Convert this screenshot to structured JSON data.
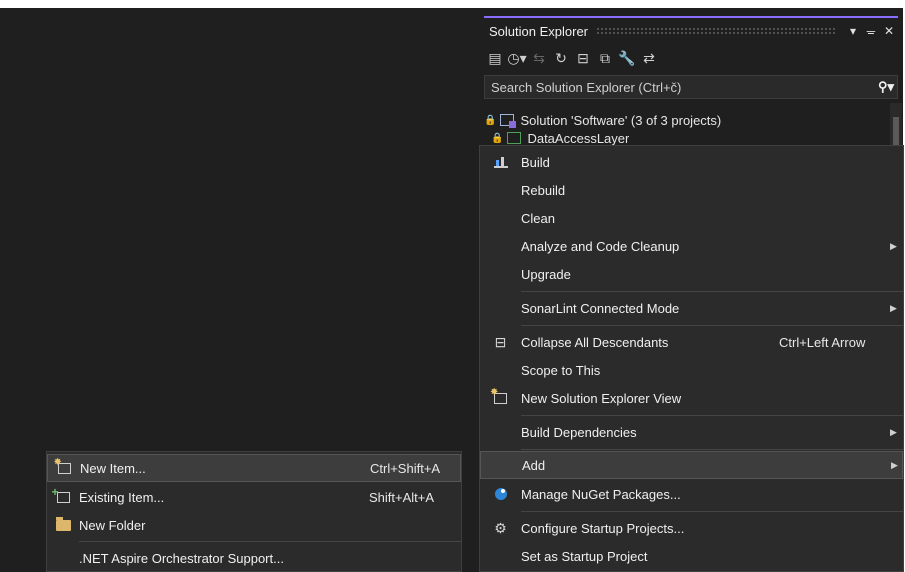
{
  "solution_explorer": {
    "title": "Solution Explorer",
    "controls": {
      "dropdown": "▾",
      "pin": "ᚚ",
      "close": "✕"
    },
    "search_placeholder": "Search Solution Explorer (Ctrl+č)",
    "tree": [
      {
        "label": "Solution 'Software' (3 of 3 projects)"
      },
      {
        "label": "DataAccessLayer"
      }
    ]
  },
  "context_menu": {
    "items": [
      {
        "label": "Build",
        "icon": "build-icon"
      },
      {
        "label": "Rebuild"
      },
      {
        "label": "Clean"
      },
      {
        "label": "Analyze and Code Cleanup",
        "submenu": true
      },
      {
        "label": "Upgrade"
      },
      {
        "label": "SonarLint Connected Mode",
        "submenu": true
      },
      {
        "label": "Collapse All Descendants",
        "shortcut": "Ctrl+Left Arrow",
        "icon": "collapse-icon"
      },
      {
        "label": "Scope to This"
      },
      {
        "label": "New Solution Explorer View",
        "icon": "new-view-icon"
      },
      {
        "label": "Build Dependencies",
        "submenu": true
      },
      {
        "label": "Add",
        "submenu": true,
        "highlighted": true
      },
      {
        "label": "Manage NuGet Packages...",
        "icon": "nuget-icon"
      },
      {
        "label": "Configure Startup Projects...",
        "icon": "gear-icon"
      },
      {
        "label": "Set as Startup Project"
      }
    ]
  },
  "add_submenu": {
    "items": [
      {
        "label": "New Item...",
        "shortcut": "Ctrl+Shift+A",
        "icon": "new-item-icon",
        "highlighted": true
      },
      {
        "label": "Existing Item...",
        "shortcut": "Shift+Alt+A",
        "icon": "existing-item-icon"
      },
      {
        "label": "New Folder",
        "icon": "new-folder-icon"
      },
      {
        "label": ".NET Aspire Orchestrator Support..."
      }
    ]
  },
  "colors": {
    "background": "#1f1f1f",
    "menu": "#2b2b2b",
    "accent": "#8b6cff"
  }
}
